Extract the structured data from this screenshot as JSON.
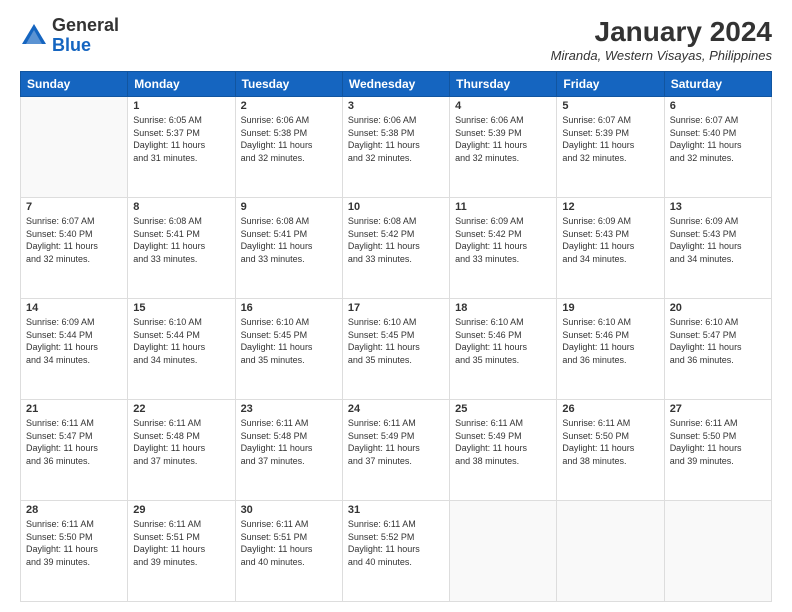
{
  "header": {
    "logo": {
      "general": "General",
      "blue": "Blue"
    },
    "title": "January 2024",
    "location": "Miranda, Western Visayas, Philippines"
  },
  "days_of_week": [
    "Sunday",
    "Monday",
    "Tuesday",
    "Wednesday",
    "Thursday",
    "Friday",
    "Saturday"
  ],
  "weeks": [
    [
      {
        "day": "",
        "info": ""
      },
      {
        "day": "1",
        "info": "Sunrise: 6:05 AM\nSunset: 5:37 PM\nDaylight: 11 hours\nand 31 minutes."
      },
      {
        "day": "2",
        "info": "Sunrise: 6:06 AM\nSunset: 5:38 PM\nDaylight: 11 hours\nand 32 minutes."
      },
      {
        "day": "3",
        "info": "Sunrise: 6:06 AM\nSunset: 5:38 PM\nDaylight: 11 hours\nand 32 minutes."
      },
      {
        "day": "4",
        "info": "Sunrise: 6:06 AM\nSunset: 5:39 PM\nDaylight: 11 hours\nand 32 minutes."
      },
      {
        "day": "5",
        "info": "Sunrise: 6:07 AM\nSunset: 5:39 PM\nDaylight: 11 hours\nand 32 minutes."
      },
      {
        "day": "6",
        "info": "Sunrise: 6:07 AM\nSunset: 5:40 PM\nDaylight: 11 hours\nand 32 minutes."
      }
    ],
    [
      {
        "day": "7",
        "info": "Sunrise: 6:07 AM\nSunset: 5:40 PM\nDaylight: 11 hours\nand 32 minutes."
      },
      {
        "day": "8",
        "info": "Sunrise: 6:08 AM\nSunset: 5:41 PM\nDaylight: 11 hours\nand 33 minutes."
      },
      {
        "day": "9",
        "info": "Sunrise: 6:08 AM\nSunset: 5:41 PM\nDaylight: 11 hours\nand 33 minutes."
      },
      {
        "day": "10",
        "info": "Sunrise: 6:08 AM\nSunset: 5:42 PM\nDaylight: 11 hours\nand 33 minutes."
      },
      {
        "day": "11",
        "info": "Sunrise: 6:09 AM\nSunset: 5:42 PM\nDaylight: 11 hours\nand 33 minutes."
      },
      {
        "day": "12",
        "info": "Sunrise: 6:09 AM\nSunset: 5:43 PM\nDaylight: 11 hours\nand 34 minutes."
      },
      {
        "day": "13",
        "info": "Sunrise: 6:09 AM\nSunset: 5:43 PM\nDaylight: 11 hours\nand 34 minutes."
      }
    ],
    [
      {
        "day": "14",
        "info": "Sunrise: 6:09 AM\nSunset: 5:44 PM\nDaylight: 11 hours\nand 34 minutes."
      },
      {
        "day": "15",
        "info": "Sunrise: 6:10 AM\nSunset: 5:44 PM\nDaylight: 11 hours\nand 34 minutes."
      },
      {
        "day": "16",
        "info": "Sunrise: 6:10 AM\nSunset: 5:45 PM\nDaylight: 11 hours\nand 35 minutes."
      },
      {
        "day": "17",
        "info": "Sunrise: 6:10 AM\nSunset: 5:45 PM\nDaylight: 11 hours\nand 35 minutes."
      },
      {
        "day": "18",
        "info": "Sunrise: 6:10 AM\nSunset: 5:46 PM\nDaylight: 11 hours\nand 35 minutes."
      },
      {
        "day": "19",
        "info": "Sunrise: 6:10 AM\nSunset: 5:46 PM\nDaylight: 11 hours\nand 36 minutes."
      },
      {
        "day": "20",
        "info": "Sunrise: 6:10 AM\nSunset: 5:47 PM\nDaylight: 11 hours\nand 36 minutes."
      }
    ],
    [
      {
        "day": "21",
        "info": "Sunrise: 6:11 AM\nSunset: 5:47 PM\nDaylight: 11 hours\nand 36 minutes."
      },
      {
        "day": "22",
        "info": "Sunrise: 6:11 AM\nSunset: 5:48 PM\nDaylight: 11 hours\nand 37 minutes."
      },
      {
        "day": "23",
        "info": "Sunrise: 6:11 AM\nSunset: 5:48 PM\nDaylight: 11 hours\nand 37 minutes."
      },
      {
        "day": "24",
        "info": "Sunrise: 6:11 AM\nSunset: 5:49 PM\nDaylight: 11 hours\nand 37 minutes."
      },
      {
        "day": "25",
        "info": "Sunrise: 6:11 AM\nSunset: 5:49 PM\nDaylight: 11 hours\nand 38 minutes."
      },
      {
        "day": "26",
        "info": "Sunrise: 6:11 AM\nSunset: 5:50 PM\nDaylight: 11 hours\nand 38 minutes."
      },
      {
        "day": "27",
        "info": "Sunrise: 6:11 AM\nSunset: 5:50 PM\nDaylight: 11 hours\nand 39 minutes."
      }
    ],
    [
      {
        "day": "28",
        "info": "Sunrise: 6:11 AM\nSunset: 5:50 PM\nDaylight: 11 hours\nand 39 minutes."
      },
      {
        "day": "29",
        "info": "Sunrise: 6:11 AM\nSunset: 5:51 PM\nDaylight: 11 hours\nand 39 minutes."
      },
      {
        "day": "30",
        "info": "Sunrise: 6:11 AM\nSunset: 5:51 PM\nDaylight: 11 hours\nand 40 minutes."
      },
      {
        "day": "31",
        "info": "Sunrise: 6:11 AM\nSunset: 5:52 PM\nDaylight: 11 hours\nand 40 minutes."
      },
      {
        "day": "",
        "info": ""
      },
      {
        "day": "",
        "info": ""
      },
      {
        "day": "",
        "info": ""
      }
    ]
  ]
}
